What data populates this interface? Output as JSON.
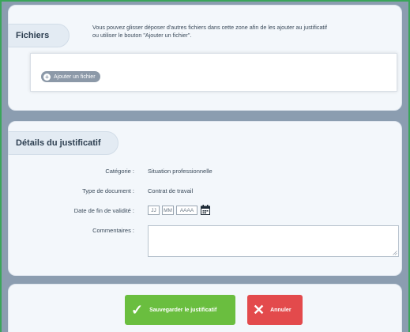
{
  "files": {
    "section_title": "Fichiers",
    "help_line1": "Vous pouvez glisser déposer d'autres fichiers dans cette zone afin de les ajouter au justificatif",
    "help_line2": "ou utiliser le bouton \"Ajouter un fichier\".",
    "add_button_label": "Ajouter un fichier",
    "add_button_icon": "plus-circle-icon"
  },
  "details": {
    "section_title": "Détails du justificatif",
    "category_label": "Catégorie :",
    "category_value": "Situation professionnelle",
    "doctype_label": "Type de document :",
    "doctype_value": "Contrat de travail",
    "validity_label": "Date de fin de validité :",
    "date_placeholders": {
      "day": "JJ",
      "month": "MM",
      "year": "AAAA"
    },
    "calendar_icon": "calendar-icon",
    "comments_label": "Commentaires :",
    "comments_value": ""
  },
  "actions": {
    "save_label": "Sauvegarder le justificatif",
    "save_icon": "checkmark-icon",
    "cancel_label": "Annuler",
    "cancel_icon": "x-icon"
  },
  "colors": {
    "frame_border": "#3aa55a",
    "background": "#8b9db0",
    "panel": "#f3f7fb",
    "save": "#6abe3f",
    "cancel": "#e34a4c"
  }
}
